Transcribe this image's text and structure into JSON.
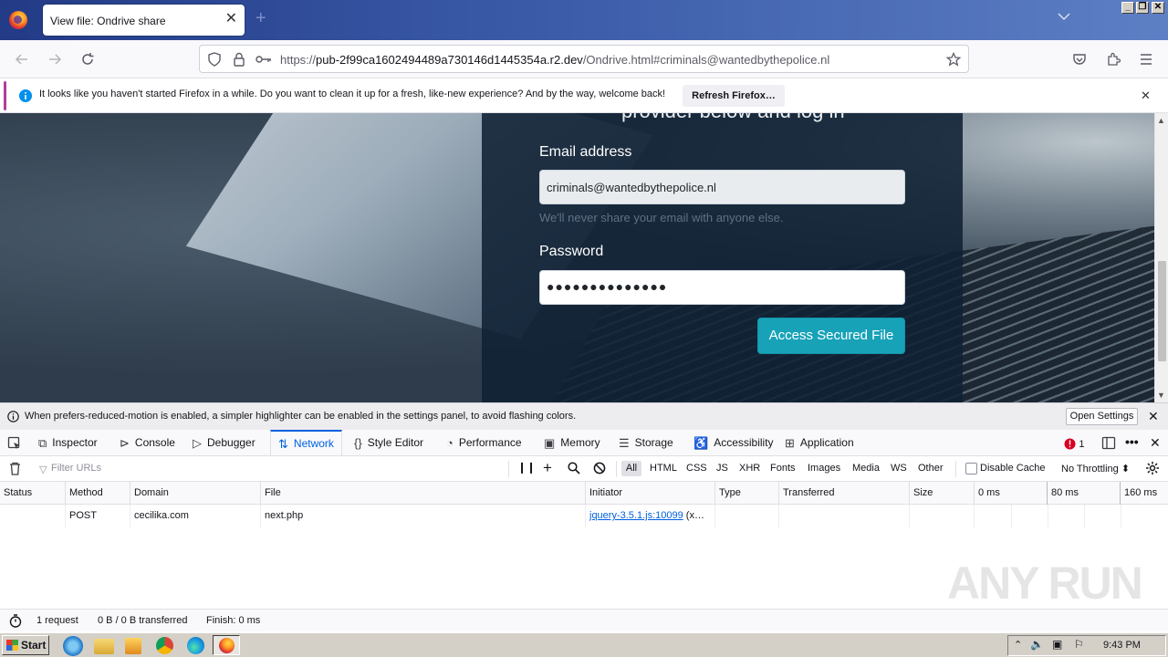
{
  "browser": {
    "tab_title": "View file: Ondrive share",
    "url_scheme": "https://",
    "url_host": "pub-2f99ca1602494489a730146d1445354a.r2.dev",
    "url_path": "/Ondrive.html#criminals@wantedbythepolice.nl",
    "tab_close": "✕",
    "new_tab": "+"
  },
  "notification": {
    "message": "It looks like you haven't started Firefox in a while. Do you want to clean it up for a fresh, like-new experience? And by the way, welcome back!",
    "button": "Refresh Firefox…",
    "close": "✕"
  },
  "page": {
    "heading_fragment": "provider below and log in",
    "email_label": "Email address",
    "email_value": "criminals@wantedbythepolice.nl",
    "email_help": "We'll never share your email with anyone else.",
    "password_label": "Password",
    "password_value": "●●●●●●●●●●●●●●",
    "submit_label": "Access Secured File"
  },
  "devtools": {
    "banner_message": "When prefers-reduced-motion is enabled, a simpler highlighter can be enabled in the settings panel, to avoid flashing colors.",
    "banner_button": "Open Settings",
    "tabs": [
      "Inspector",
      "Console",
      "Debugger",
      "Network",
      "Style Editor",
      "Performance",
      "Memory",
      "Storage",
      "Accessibility",
      "Application"
    ],
    "active_tab": "Network",
    "error_count": "1",
    "filter_placeholder": "Filter URLs",
    "filters": [
      "All",
      "HTML",
      "CSS",
      "JS",
      "XHR",
      "Fonts",
      "Images",
      "Media",
      "WS",
      "Other"
    ],
    "disable_cache": "Disable Cache",
    "throttling": "No Throttling ⬍",
    "columns": [
      "Status",
      "Method",
      "Domain",
      "File",
      "Initiator",
      "Type",
      "Transferred",
      "Size"
    ],
    "waterfall_ticks": [
      "0 ms",
      "80 ms",
      "160 ms"
    ],
    "request": {
      "status": "",
      "method": "POST",
      "domain": "cecilika.com",
      "file": "next.php",
      "initiator": "jquery-3.5.1.js:10099",
      "initiator_suffix": " (x…",
      "type": "",
      "transferred": "",
      "size": ""
    },
    "status_bar": {
      "requests": "1 request",
      "transferred": "0 B / 0 B transferred",
      "finish": "Finish: 0 ms"
    }
  },
  "watermark": "ANY RUN",
  "taskbar": {
    "start": "Start",
    "clock": "9:43 PM"
  },
  "colors": {
    "accent": "#0060df",
    "submit": "#17a2b8",
    "error": "#d70022"
  }
}
